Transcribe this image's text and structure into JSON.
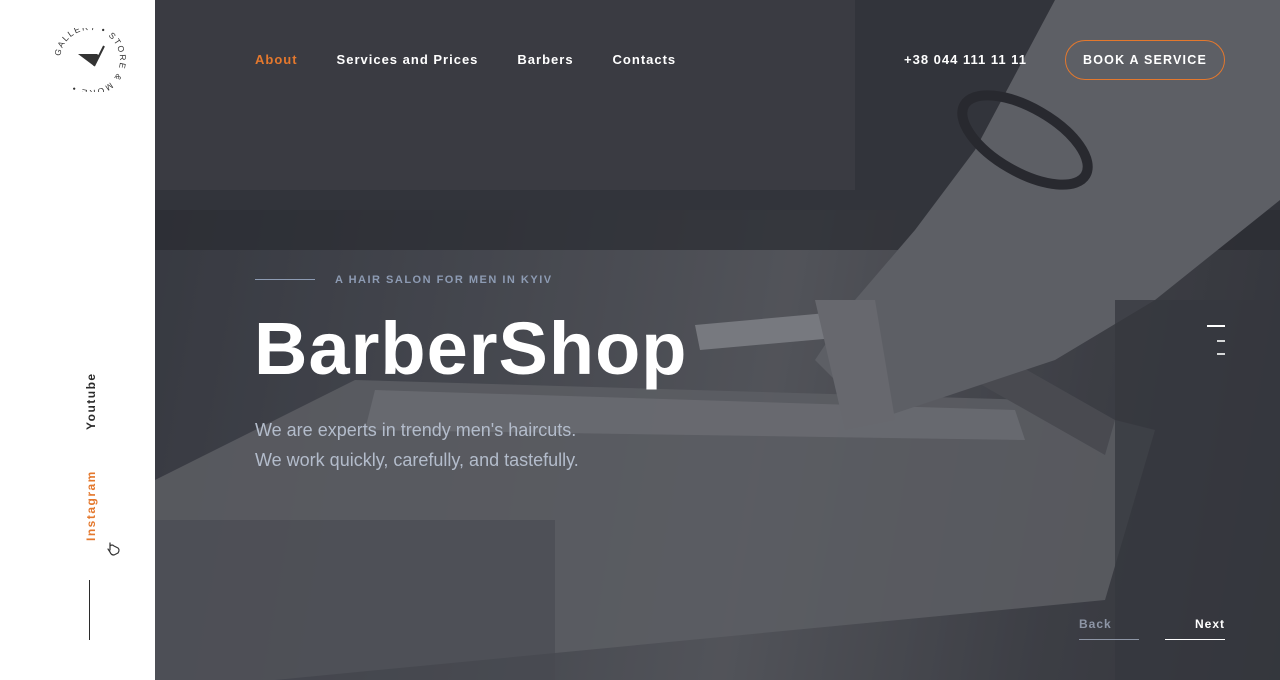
{
  "logo": {
    "ring_text": "GALLERY • STORE & MORE •"
  },
  "nav": {
    "items": [
      {
        "label": "About",
        "active": true
      },
      {
        "label": "Services and Prices",
        "active": false
      },
      {
        "label": "Barbers",
        "active": false
      },
      {
        "label": "Contacts",
        "active": false
      }
    ]
  },
  "header": {
    "phone": "+38 044 111 11 11",
    "book_label": "BOOK A SERVICE"
  },
  "hero": {
    "eyebrow": "A HAIR SALON FOR MEN IN KYIV",
    "title": "BarberShop",
    "desc_line1": "We are experts in trendy men's haircuts.",
    "desc_line2": "We work quickly, carefully, and tastefully."
  },
  "social": {
    "youtube": "Youtube",
    "instagram": "Instagram",
    "hand_icon": "pointer-hand-icon"
  },
  "pager": {
    "back": "Back",
    "next": "Next",
    "slide_count": 3,
    "active_slide": 1
  },
  "colors": {
    "accent": "#e4782d",
    "hero_text_muted": "#8d9bb3",
    "sidebar_bg": "#ffffff"
  }
}
